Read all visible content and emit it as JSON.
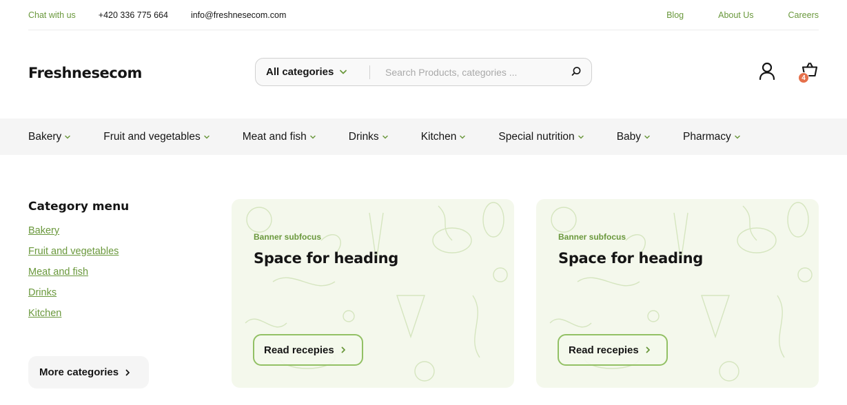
{
  "topbar": {
    "chat": "Chat with us",
    "phone": "+420 336 775 664",
    "email": "info@freshnesecom.com",
    "links": [
      "Blog",
      "About Us",
      "Careers"
    ]
  },
  "header": {
    "logo": "Freshnesecom",
    "search": {
      "category_label": "All categories",
      "placeholder": "Search Products, categories ..."
    },
    "cart_count": "4"
  },
  "nav": {
    "items": [
      "Bakery",
      "Fruit and vegetables",
      "Meat and fish",
      "Drinks",
      "Kitchen",
      "Special nutrition",
      "Baby",
      "Pharmacy"
    ]
  },
  "sidebar": {
    "title": "Category menu",
    "links": [
      "Bakery",
      "Fruit and vegetables",
      "Meat and fish",
      "Drinks",
      "Kitchen"
    ],
    "more_label": "More categories"
  },
  "banners": [
    {
      "subfocus": "Banner subfocus",
      "heading": "Space for heading",
      "button": "Read recepies"
    },
    {
      "subfocus": "Banner subfocus",
      "heading": "Space for heading",
      "button": "Read recepies"
    }
  ],
  "colors": {
    "accent": "#6a983c",
    "accent_border": "#92c064",
    "badge": "#e5704b",
    "banner_bg": "#f4f8ec",
    "nav_bg": "#f5f5f5"
  },
  "icons": {
    "search": "search-icon",
    "user": "user-icon",
    "cart": "basket-icon",
    "chevron": "chevron-down-icon",
    "arrow": "chevron-right-icon"
  }
}
